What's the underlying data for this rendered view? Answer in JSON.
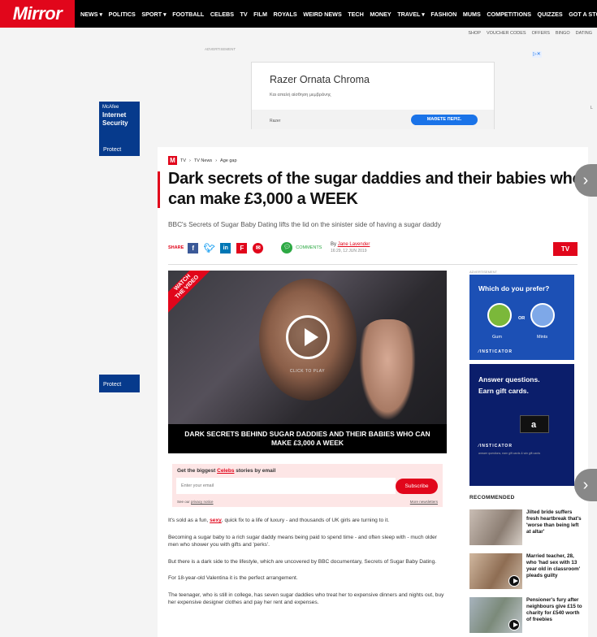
{
  "site": {
    "logo": "Mirror"
  },
  "nav": [
    "NEWS ▾",
    "POLITICS",
    "SPORT ▾",
    "FOOTBALL",
    "CELEBS",
    "TV",
    "FILM",
    "ROYALS",
    "WEIRD NEWS",
    "TECH",
    "MONEY",
    "TRAVEL ▾",
    "FASHION",
    "MUMS",
    "COMPETITIONS",
    "QUIZZES",
    "GOT A STORY?"
  ],
  "subnav": [
    "SHOP",
    "VOUCHER CODES",
    "OFFERS",
    "BINGO",
    "DATING"
  ],
  "ad_top": {
    "label": "ADVERTISEMENT",
    "title": "Razer Ornata Chroma",
    "subtitle": "Και απαλή αίσθηση μεμβράνης",
    "brand": "Razer",
    "cta": "ΜΑΘΕΤΕ ΠΕΡΙΣ."
  },
  "mcafee": {
    "brand": "McAfee",
    "product": "Internet Security",
    "cta": "Protect",
    "cta2": "Protect"
  },
  "breadcrumb": {
    "badge": "M",
    "items": [
      "TV",
      "TV News",
      "Age gap"
    ]
  },
  "article": {
    "headline": "Dark secrets of the sugar daddies and their babies who can make £3,000 a WEEK",
    "standfirst": "BBC's Secrets of Sugar Baby Dating lifts the lid on the sinister side of having a sugar daddy",
    "share_label": "SHARE",
    "comments_label": "COMMENTS",
    "by": "By",
    "author": "Jane Lavender",
    "date": "16:29, 12 JUN 2019",
    "section_button": "TV"
  },
  "video": {
    "watch_line1": "WATCH",
    "watch_line2": "THE VIDEO",
    "click_to_play": "CLICK TO PLAY",
    "caption": "DARK SECRETS BEHIND SUGAR DADDIES AND THEIR BABIES WHO CAN MAKE £3,000 A WEEK"
  },
  "newsletter": {
    "heading_pre": "Get the biggest",
    "heading_link": "Celebs",
    "heading_post": "stories by email",
    "placeholder": "Enter your email",
    "subscribe": "Subscribe",
    "privacy_pre": "See our",
    "privacy_link": "privacy notice",
    "more": "More newsletters"
  },
  "body": {
    "p1_pre": "It's sold as a fun,",
    "p1_link": "sexy",
    "p1_post": ", quick fix to a life of luxury - and thousands of UK girls are turning to it.",
    "p2": "Becoming a sugar baby to a rich sugar daddy means being paid to spend time - and often sleep with - much older men who shower you with gifts and 'perks'.",
    "p3": "But there is a dark side to the lifestyle, which are uncovered by BBC documentary, Secrets of Sugar Baby Dating.",
    "p4": "For 18-year-old Valentina it is the perfect arrangement.",
    "p5": "The teenager, who is still in college, has seven sugar daddies who treat her to expensive dinners and nights out, buy her expensive designer clothes and pay her rent and expenses."
  },
  "side_ad": {
    "label": "ADVERTISEMENT",
    "q1_title": "Which do you prefer?",
    "or": "OR",
    "opt1": "Gum",
    "opt2": "Mints",
    "insticator": "⁄INSTICATOR",
    "q2_title_1": "Answer questions.",
    "q2_title_2": "Earn gift cards.",
    "q2_card": "a",
    "insticator2": "⁄INSTICATOR",
    "fine": "answer questions, earn gift cards & win gift cards"
  },
  "recommended": {
    "heading": "RECOMMENDED",
    "items": [
      {
        "title": "Jilted bride suffers fresh heartbreak that's 'worse than being left at altar'"
      },
      {
        "title": "Married teacher, 28, who 'had sex with 13 year old in classroom' pleads guilty"
      },
      {
        "title": "Pensioner's fury after neighbours give £15 to charity for £540 worth of freebies"
      }
    ]
  },
  "colors": {
    "brand_red": "#e1061b",
    "nav_bg": "#000000",
    "insticator_blue": "#1c50b5"
  }
}
